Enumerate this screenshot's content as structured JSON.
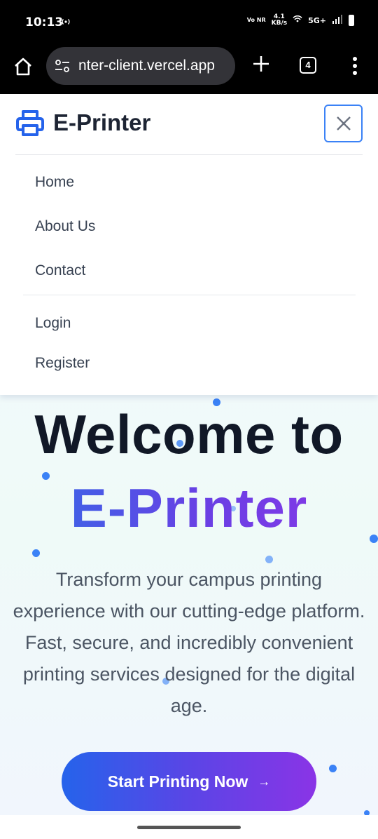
{
  "status_bar": {
    "time": "10:13",
    "hotspot_icon": "hotspot-icon",
    "vonr": "Vo NR",
    "net_speed_value": "4.1",
    "net_speed_unit": "KB/s",
    "network": "5G+"
  },
  "browser": {
    "url": "nter-client.vercel.app",
    "tab_count": "4"
  },
  "nav": {
    "brand": "E-Printer",
    "links": [
      "Home",
      "About Us",
      "Contact"
    ],
    "auth_links": [
      "Login",
      "Register"
    ]
  },
  "hero": {
    "title_line1": "Welcome to",
    "title_line2": "E-Printer",
    "description": "Transform your campus printing experience with our cutting-edge platform. Fast, secure, and incredibly convenient printing services designed for the digital age.",
    "cta_label": "Start Printing Now",
    "cta_arrow": "→"
  },
  "colors": {
    "accent_blue": "#3b82f6",
    "gradient_start": "#2563eb",
    "gradient_end": "#8a34e6",
    "heading": "#111827"
  }
}
